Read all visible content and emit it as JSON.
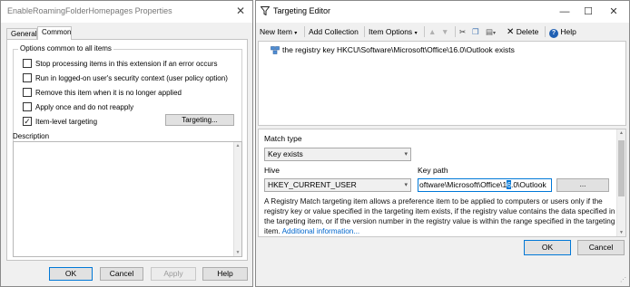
{
  "left_window": {
    "title": "EnableRoamingFolderHomepages Properties",
    "tabs": [
      "General",
      "Common"
    ],
    "options_group_title": "Options common to all items",
    "options": [
      {
        "label": "Stop processing items in this extension if an error occurs",
        "checked": false
      },
      {
        "label": "Run in logged-on user's security context (user policy option)",
        "checked": false
      },
      {
        "label": "Remove this item when it is no longer applied",
        "checked": false
      },
      {
        "label": "Apply once and do not reapply",
        "checked": false
      },
      {
        "label": "Item-level targeting",
        "checked": true
      }
    ],
    "targeting_button": "Targeting...",
    "description_label": "Description",
    "buttons": {
      "ok": "OK",
      "cancel": "Cancel",
      "apply": "Apply",
      "help": "Help"
    }
  },
  "right_window": {
    "title": "Targeting Editor",
    "toolbar": {
      "new_item": "New Item",
      "add_collection": "Add Collection",
      "item_options": "Item Options",
      "delete": "Delete",
      "help": "Help"
    },
    "tree_item": "the registry key HKCU\\Software\\Microsoft\\Office\\16.0\\Outlook exists",
    "match_type_label": "Match type",
    "match_type_value": "Key exists",
    "hive_label": "Hive",
    "hive_value": "HKEY_CURRENT_USER",
    "key_path_label": "Key path",
    "key_path_before": "oftware\\Microsoft\\Office\\1",
    "key_path_selected": "6",
    "key_path_after": ".0\\Outlook",
    "browse_button": "...",
    "description": "A Registry Match targeting item allows a preference item to be applied to computers or users only if the registry key or value specified in the targeting item exists, if the registry value contains the data specified in the targeting item, or if the version number in the registry value is within the range specified in the targeting item.",
    "description_link": "Additional information...",
    "buttons": {
      "ok": "OK",
      "cancel": "Cancel"
    }
  },
  "colors": {
    "accent": "#0078d7",
    "window_bg": "#f0f0f0",
    "link": "#0066cc"
  }
}
